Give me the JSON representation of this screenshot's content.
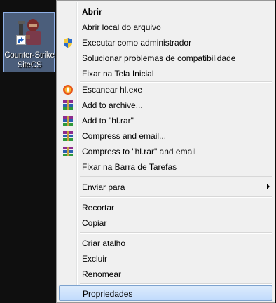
{
  "desktop_icon": {
    "label_line1": "Counter-Strike",
    "label_line2": "SiteCS",
    "icon": "counter-strike-soldier-icon"
  },
  "context_menu": {
    "items": [
      {
        "label": "Abrir",
        "icon": ""
      },
      {
        "label": "Abrir local do arquivo",
        "icon": ""
      },
      {
        "label": "Executar como administrador",
        "icon": "uac-shield-icon"
      },
      {
        "label": "Solucionar problemas de compatibilidade",
        "icon": ""
      },
      {
        "label": "Fixar na Tela Inicial",
        "icon": ""
      },
      {
        "label": "Escanear hl.exe",
        "icon": "antivirus-icon"
      },
      {
        "label": "Add to archive...",
        "icon": "winrar-icon"
      },
      {
        "label": "Add to \"hl.rar\"",
        "icon": "winrar-icon"
      },
      {
        "label": "Compress and email...",
        "icon": "winrar-icon"
      },
      {
        "label": "Compress to \"hl.rar\" and email",
        "icon": "winrar-icon"
      },
      {
        "label": "Fixar na Barra de Tarefas",
        "icon": ""
      },
      {
        "label": "Enviar para",
        "icon": "submenu-arrow-icon"
      },
      {
        "label": "Recortar",
        "icon": ""
      },
      {
        "label": "Copiar",
        "icon": ""
      },
      {
        "label": "Criar atalho",
        "icon": ""
      },
      {
        "label": "Excluir",
        "icon": ""
      },
      {
        "label": "Renomear",
        "icon": ""
      },
      {
        "label": "Propriedades",
        "icon": ""
      }
    ],
    "highlighted_item": "Propriedades"
  },
  "colors": {
    "menu_bg": "#f0f0f0",
    "highlight_border": "#7da2ce",
    "selection_bg": "#7ea0d6"
  }
}
